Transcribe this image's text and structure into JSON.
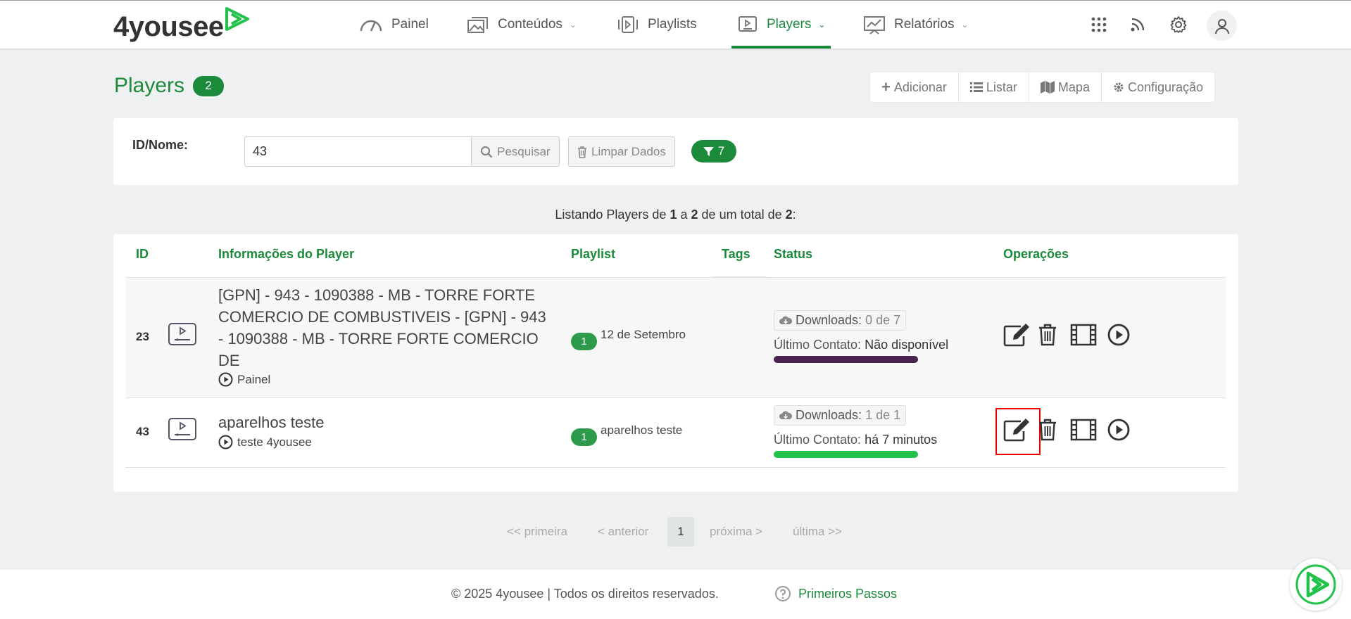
{
  "brand": {
    "name": "4yousee",
    "accent": "#1b8a3a"
  },
  "nav": {
    "items": [
      {
        "label": "Painel",
        "icon": "gauge-icon"
      },
      {
        "label": "Conteúdos",
        "icon": "images-icon"
      },
      {
        "label": "Playlists",
        "icon": "playlist-icon"
      },
      {
        "label": "Players",
        "icon": "player-icon",
        "active": true
      },
      {
        "label": "Relatórios",
        "icon": "chart-icon"
      }
    ],
    "right_icons": [
      "apps-grid-icon",
      "rss-icon",
      "gear-icon",
      "user-icon"
    ]
  },
  "page": {
    "title": "Players",
    "count": "2"
  },
  "actions": {
    "add": "Adicionar",
    "list": "Listar",
    "map": "Mapa",
    "config": "Configuração"
  },
  "filter": {
    "label": "ID/Nome:",
    "value": "43",
    "search": "Pesquisar",
    "clear": "Limpar Dados",
    "filter_count": "7"
  },
  "listing": {
    "prefix": "Listando Players de",
    "from": "1",
    "a": "a",
    "to": "2",
    "mid": "de um total de",
    "total": "2",
    "suffix": ":"
  },
  "table": {
    "headers": {
      "id": "ID",
      "info": "Informações do Player",
      "playlist": "Playlist",
      "tags": "Tags",
      "status": "Status",
      "ops": "Operações"
    },
    "rows": [
      {
        "id": "23",
        "name_lines": [
          "[GPN] - 943 - 1090388 - MB - TORRE FORTE",
          "COMERCIO DE COMBUSTIVEIS - [GPN] - 943",
          "- 1090388 - MB - TORRE FORTE COMERCIO",
          "DE"
        ],
        "group": "Painel",
        "playlist_count": "1",
        "playlist": "12 de Setembro",
        "downloads_label": "Downloads:",
        "downloads": "0 de 7",
        "contact_label": "Último Contato:",
        "contact": "Não disponível",
        "status_color": "#4a2451"
      },
      {
        "id": "43",
        "name_lines": [
          "aparelhos teste"
        ],
        "group": "teste 4yousee",
        "playlist_count": "1",
        "playlist": "aparelhos teste",
        "downloads_label": "Downloads:",
        "downloads": "1 de 1",
        "contact_label": "Último Contato:",
        "contact": "há 7 minutos",
        "status_color": "#22c24a"
      }
    ]
  },
  "pagination": {
    "first": "<< primeira",
    "prev": "< anterior",
    "current": "1",
    "next": "próxima >",
    "last": "última >>"
  },
  "footer": {
    "copyright": "© 2025 4yousee | Todos os direitos reservados.",
    "help": "Primeiros Passos"
  }
}
